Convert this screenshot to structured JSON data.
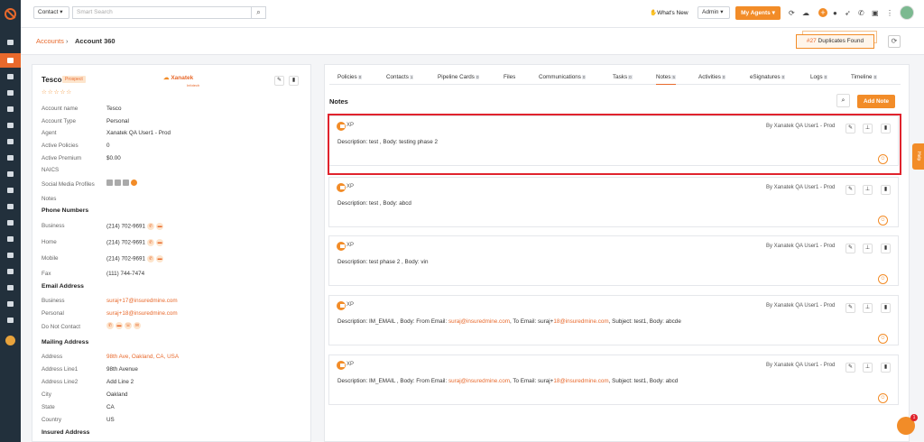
{
  "topbar": {
    "search_scope": "Contact",
    "search_placeholder": "Smart Search",
    "whats_new": "What's New",
    "admin": "Admin",
    "my_agents": "My Agents"
  },
  "breadcrumb": {
    "parent": "Accounts",
    "current": "Account 360"
  },
  "duplicates": {
    "count": "#27",
    "label": "Duplicates Found"
  },
  "account": {
    "name": "Tesco",
    "status": "Prospect",
    "stars": "☆☆☆☆☆",
    "agency_logo_text": "Xanatek",
    "agency_logo_sub": "Infotech",
    "fields": [
      {
        "label": "Account name",
        "value": "Tesco"
      },
      {
        "label": "Account Type",
        "value": "Personal"
      },
      {
        "label": "Agent",
        "value": "Xanatek QA User1 - Prod"
      },
      {
        "label": "Active Policies",
        "value": "0"
      },
      {
        "label": "Active Premium",
        "value": "$0.00"
      },
      {
        "label": "NAICS",
        "value": ""
      },
      {
        "label": "Social Media Profiles",
        "value": ""
      },
      {
        "label": "Notes",
        "value": ""
      }
    ],
    "phone_header": "Phone Numbers",
    "phones": [
      {
        "label": "Business",
        "value": "(214) 702-9691"
      },
      {
        "label": "Home",
        "value": "(214) 702-9691"
      },
      {
        "label": "Mobile",
        "value": "(214) 702-9691"
      },
      {
        "label": "Fax",
        "value": "(111) 744-7474"
      }
    ],
    "email_header": "Email Address",
    "emails": [
      {
        "label": "Business",
        "value": "suraj+17@insuredmine.com"
      },
      {
        "label": "Personal",
        "value": "suraj+18@insuredmine.com"
      },
      {
        "label": "Do Not Contact",
        "value": ""
      }
    ],
    "mailing_header": "Mailing Address",
    "mailing": [
      {
        "label": "Address",
        "value": "98th Ave, Oakland, CA, USA"
      },
      {
        "label": "Address Line1",
        "value": "98th Avenue"
      },
      {
        "label": "Address Line2",
        "value": "Add Line 2"
      },
      {
        "label": "City",
        "value": "Oakland"
      },
      {
        "label": "State",
        "value": "CA"
      },
      {
        "label": "Country",
        "value": "US"
      }
    ],
    "insured_header": "Insured Address"
  },
  "tabs": [
    {
      "label": "Policies",
      "count": "0"
    },
    {
      "label": "Contacts",
      "count": "1"
    },
    {
      "label": "Pipeline Cards",
      "count": "0"
    },
    {
      "label": "Files",
      "count": ""
    },
    {
      "label": "Communications",
      "count": "0"
    },
    {
      "label": "Tasks",
      "count": "0"
    },
    {
      "label": "Notes",
      "count": "5"
    },
    {
      "label": "Activities",
      "count": "0"
    },
    {
      "label": "eSignatures",
      "count": "0"
    },
    {
      "label": "Logs",
      "count": "0"
    },
    {
      "label": "Timeline",
      "count": "0"
    }
  ],
  "notes_title": "Notes",
  "add_note": "Add Note",
  "notes": [
    {
      "initials": "XP",
      "by": "By Xanatek QA User1 - Prod",
      "body": "Description: test , Body: testing phase 2"
    },
    {
      "initials": "XP",
      "by": "By Xanatek QA User1 - Prod",
      "body": "Description: test , Body: abcd"
    },
    {
      "initials": "XP",
      "by": "By Xanatek QA User1 - Prod",
      "body": "Description: test phase 2 , Body: vin"
    },
    {
      "initials": "XP",
      "by": "By Xanatek QA User1 - Prod",
      "body_pre": "Description: IM_EMAIL , Body: From Email: ",
      "email1": "suraj@insuredmine.com",
      "body_mid": ", To Email: suraj+",
      "email2": "18@insuredmine.com",
      "body_post": ", Subject: test1, Body: abcde"
    },
    {
      "initials": "XP",
      "by": "By Xanatek QA User1 - Prod",
      "body_pre": "Description: IM_EMAIL , Body: From Email: ",
      "email1": "suraj@insuredmine.com",
      "body_mid": ", To Email: suraj+",
      "email2": "18@insuredmine.com",
      "body_post": ", Subject: test1, Body: abcd"
    }
  ],
  "help": "Help"
}
